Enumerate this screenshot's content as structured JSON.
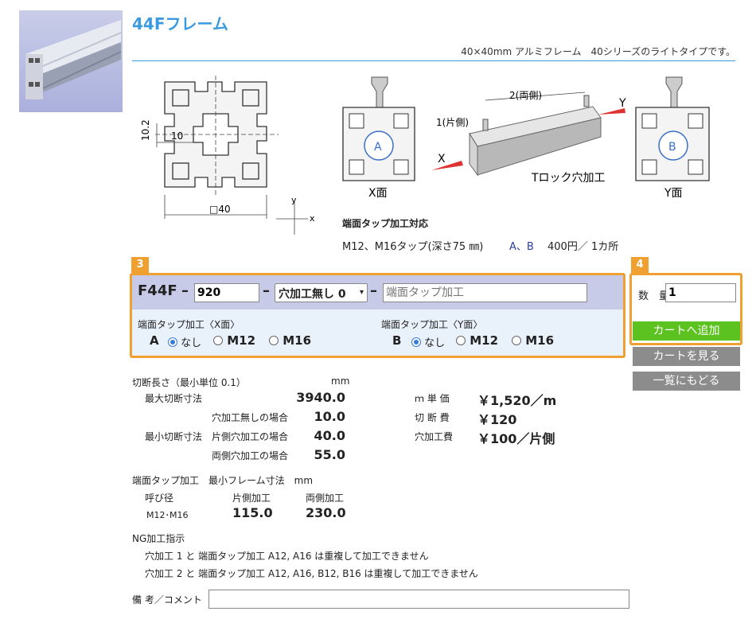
{
  "product": {
    "title": "44Fフレーム",
    "subtitle": "40×40mm アルミフレーム　40シリーズのライトタイプです。"
  },
  "drawing": {
    "dim_10_2": "10.2",
    "dim_10": "10",
    "dim_40": "□40",
    "axis_y": "y",
    "axis_x": "x",
    "x_face": "X面",
    "y_face": "Y面",
    "label_a": "A",
    "label_b": "B",
    "one_side": "1(片側)",
    "both_sides": "2(両側)",
    "arrow_x": "X",
    "arrow_y": "Y",
    "tlock": "Tロック穴加工"
  },
  "tap_info": {
    "heading": "端面タップ加工対応",
    "spec": "M12、M16タップ(深さ75 ㎜)",
    "codes": "A、B",
    "price": "400円／ 1カ所"
  },
  "order": {
    "badge3": "3",
    "badge4": "4",
    "code": "F44F",
    "dash": "–",
    "length_value": "920",
    "hole_select": "穴加工無し  0",
    "tap_placeholder": "端面タップ加工",
    "x_face_label": "端面タップ加工〈X面〉",
    "y_face_label": "端面タップ加工〈Y面〉",
    "a": "A",
    "b": "B",
    "opt_none": "なし",
    "opt_m12": "M12",
    "opt_m16": "M16",
    "qty_label": "数　量",
    "qty_value": "1",
    "add_to_cart": "カートへ追加",
    "view_cart": "カートを見る",
    "back_to_list": "一覧にもどる",
    "colors": {
      "add": "#5cc21f",
      "gray": "#8c8c8c",
      "badge": "#f0a030"
    }
  },
  "specs": {
    "cut_length_header": "切断長さ（最小単位 0.1）",
    "unit_mm": "mm",
    "max_cut": "最大切断寸法",
    "max_cut_val": "3940.0",
    "no_hole": "穴加工無しの場合",
    "no_hole_val": "10.0",
    "min_cut": "最小切断寸法",
    "one_side": "片側穴加工の場合",
    "one_side_val": "40.0",
    "both_side": "両側穴加工の場合",
    "both_side_val": "55.0",
    "price_m": "ｍ 単 価",
    "price_m_val": "￥1,520／m",
    "cut_fee": "切 断 費",
    "cut_fee_val": "￥120",
    "hole_fee": "穴加工費",
    "hole_fee_val": "￥100／片側",
    "tap_min_header": "端面タップ加工　最小フレーム寸法　mm",
    "col_size": "呼び径",
    "col_one": "片側加工",
    "col_both": "両側加工",
    "row_size": "M12･M16",
    "row_one": "115.0",
    "row_both": "230.0",
    "ng_header": "NG加工指示",
    "ng1": "穴加工 1 と 端面タップ加工 A12, A16 は重複して加工できません",
    "ng2": "穴加工 2 と 端面タップ加工 A12, A16, B12, B16 は重複して加工できません",
    "remark_label": "備 考／コメント"
  }
}
